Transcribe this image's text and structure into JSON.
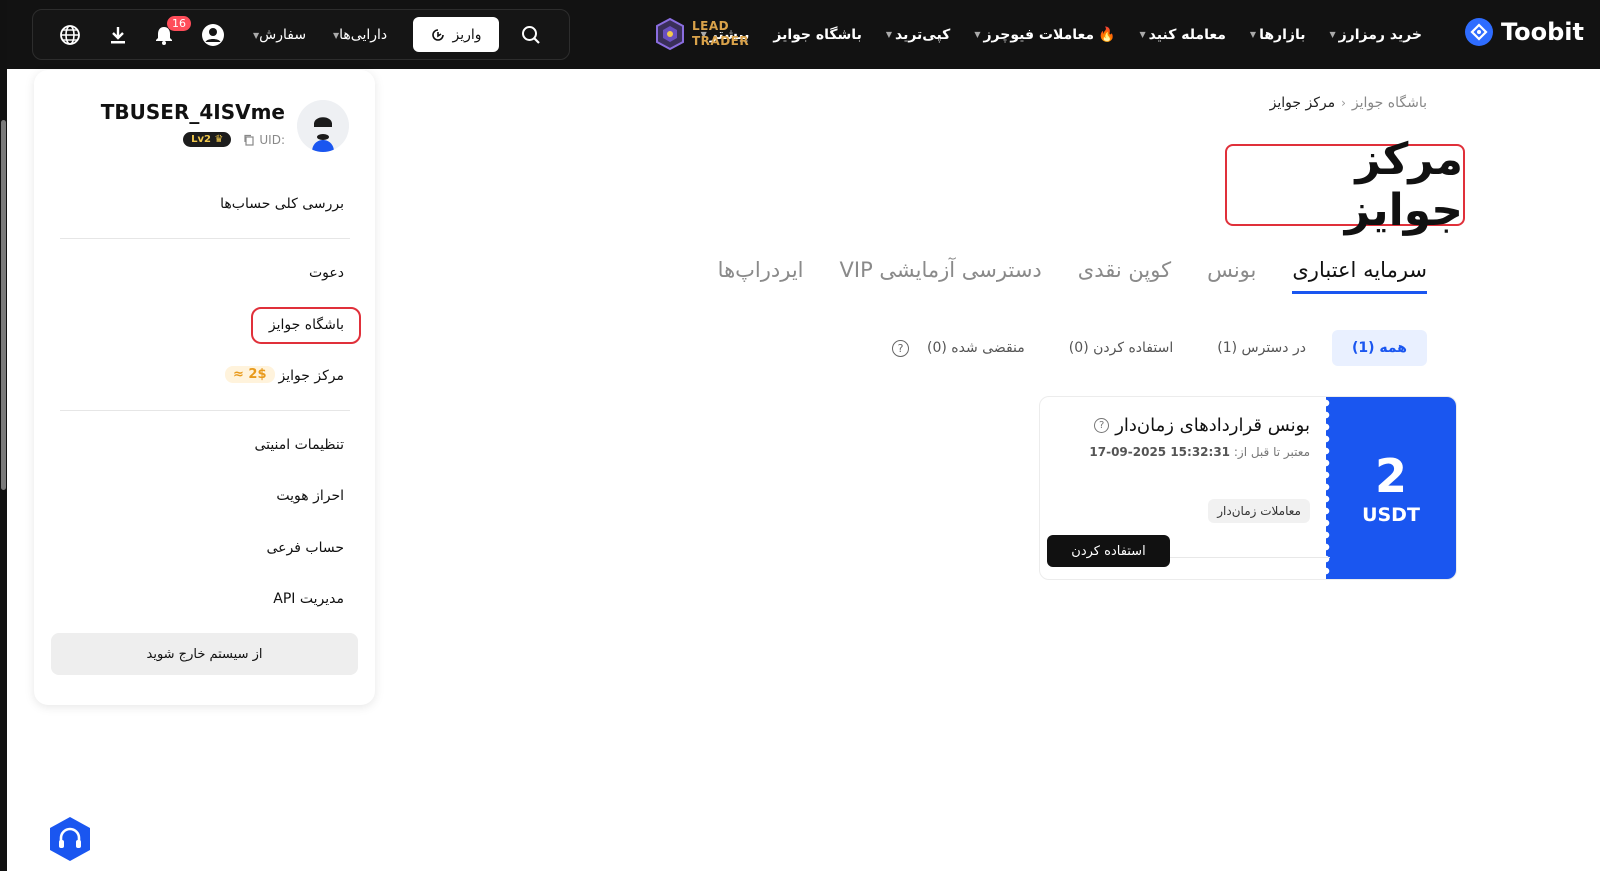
{
  "brand": {
    "name": "Toobit",
    "accent": "#1a56f0"
  },
  "lead_trader": {
    "line1": "LEAD",
    "line2": "TRADER"
  },
  "nav": {
    "items": [
      {
        "label": "خرید رمزارز",
        "caret": true
      },
      {
        "label": "بازارها",
        "caret": true
      },
      {
        "label": "معامله کنید",
        "caret": true
      },
      {
        "label": "معاملات فیوچرز",
        "caret": true,
        "fire": true
      },
      {
        "label": "کپی‌ترید",
        "caret": true
      },
      {
        "label": "باشگاه جوایز",
        "caret": false
      },
      {
        "label": "بیشتر",
        "caret": true
      }
    ]
  },
  "toolbar": {
    "deposit_label": "واریز",
    "assets_label": "دارایی‌ها",
    "orders_label": "سفارش",
    "notification_count": "16"
  },
  "sidebar": {
    "username": "TBUSER_4ISVme",
    "uid_label": "UID:",
    "level": "Lv2",
    "items": {
      "overview": "بررسی کلی حساب‌ها",
      "invite": "دعوت",
      "rewards_club": "باشگاه جوایز",
      "rewards_center": "مرکز جوایز",
      "rewards_value": "≈ 2$",
      "security": "تنظیمات امنیتی",
      "kyc": "احراز هویت",
      "sub_account": "حساب فرعی",
      "api": "مدیریت API"
    },
    "logout_label": "از سیستم خارج شوید"
  },
  "breadcrumb": {
    "parent": "باشگاه جوایز",
    "current": "مرکز جوایز"
  },
  "page_title": "مرکز جوایز",
  "tabs": [
    {
      "label": "سرمایه اعتباری",
      "active": true
    },
    {
      "label": "بونس",
      "active": false
    },
    {
      "label": "کوپن نقدی",
      "active": false
    },
    {
      "label": "دسترسی آزمایشی VIP",
      "active": false
    },
    {
      "label": "ایردراپ‌ها",
      "active": false
    }
  ],
  "filters": [
    {
      "label": "همه (1)",
      "active": true
    },
    {
      "label": "در دسترس (1)",
      "active": false
    },
    {
      "label": "استفاده کردن (0)",
      "active": false
    },
    {
      "label": "منقضی شده (0)",
      "active": false
    }
  ],
  "coupon": {
    "amount": "2",
    "currency": "USDT",
    "title": "بونس قراردادهای زمان‌دار",
    "valid_prefix": "معتبر تا قبل از:",
    "valid_until": "17-09-2025 15:32:31",
    "tag": "معاملات زمان‌دار",
    "use_label": "استفاده کردن"
  }
}
